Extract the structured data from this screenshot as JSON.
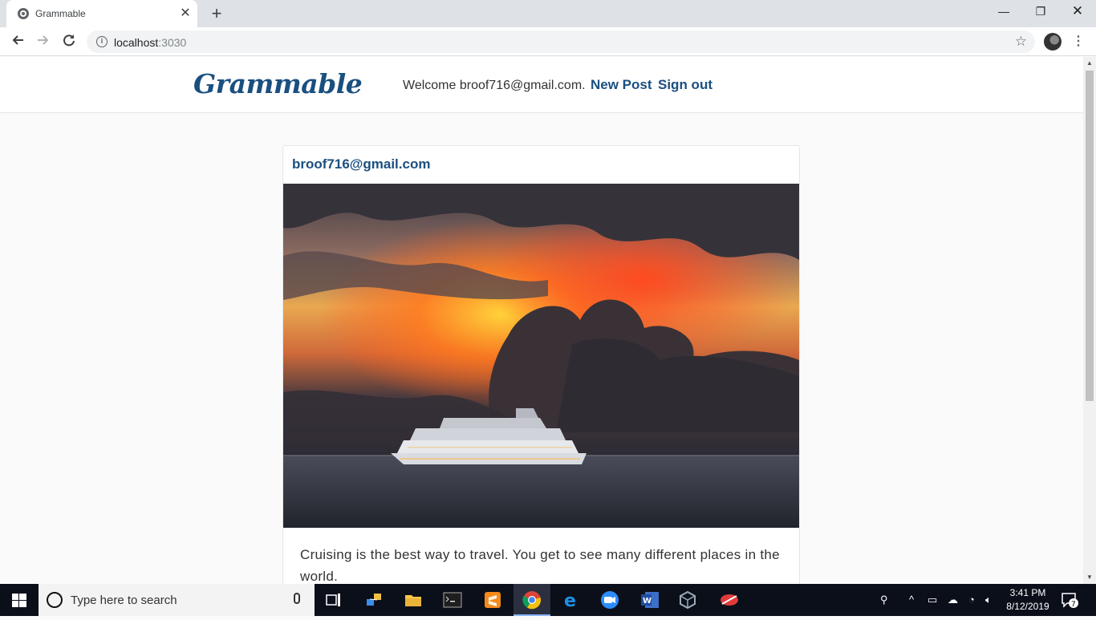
{
  "browser": {
    "tab_title": "Grammable",
    "url_host": "localhost",
    "url_port": ":3030"
  },
  "site": {
    "brand": "Grammable",
    "welcome": "Welcome broof716@gmail.com.",
    "new_post_label": "New Post",
    "sign_out_label": "Sign out"
  },
  "post": {
    "author": "broof716@gmail.com",
    "image_alt": "cruise ship at sunset",
    "caption": "Cruising is the best way to travel. You get to see many different places in the world."
  },
  "taskbar": {
    "search_placeholder": "Type here to search",
    "time": "3:41 PM",
    "date": "8/12/2019",
    "notification_count": "7",
    "pinned_apps": [
      "task-view",
      "network-app",
      "file-explorer",
      "terminal",
      "sublime-text",
      "chrome",
      "edge",
      "zoom",
      "word",
      "virtualbox",
      "snipping-tool"
    ]
  }
}
